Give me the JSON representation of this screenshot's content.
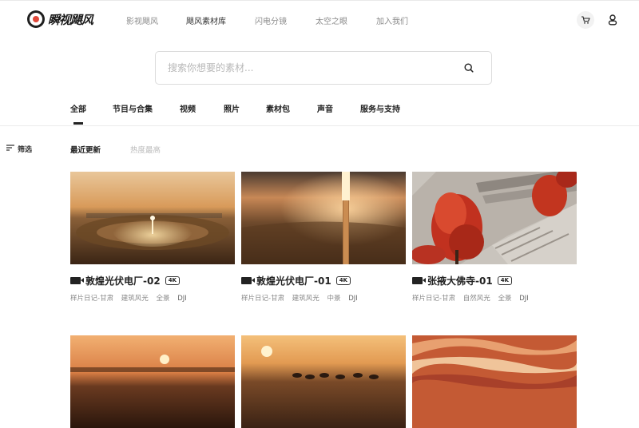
{
  "header": {
    "logo_text": "瞬视飓风",
    "nav": [
      "影视飓风",
      "飓风素材库",
      "闪电分镜",
      "太空之眼",
      "加入我们"
    ],
    "active_nav_index": 1,
    "icons": [
      "cart-icon",
      "user-icon"
    ]
  },
  "search": {
    "placeholder": "搜索你想要的素材...",
    "icon": "search-icon"
  },
  "tabs": [
    "全部",
    "节目与合集",
    "视频",
    "照片",
    "素材包",
    "声音",
    "服务与支持"
  ],
  "active_tab_index": 0,
  "filter": {
    "label": "筛选",
    "icon": "filter-icon"
  },
  "sort": [
    "最近更新",
    "热度最高"
  ],
  "active_sort_index": 0,
  "cards": [
    {
      "title": "敦煌光伏电厂-02",
      "badge": "4K",
      "tags": [
        "样片日记-甘肃",
        "建筑风光",
        "全景",
        "DJI"
      ],
      "type_icon": "video-camera-icon"
    },
    {
      "title": "敦煌光伏电厂-01",
      "badge": "4K",
      "tags": [
        "样片日记-甘肃",
        "建筑风光",
        "中景",
        "DJI"
      ],
      "type_icon": "video-camera-icon"
    },
    {
      "title": "张掖大佛寺-01",
      "badge": "4K",
      "tags": [
        "样片日记-甘肃",
        "自然风光",
        "全景",
        "DJI"
      ],
      "type_icon": "video-camera-icon"
    },
    {
      "title": "",
      "badge": "",
      "tags": [],
      "type_icon": ""
    },
    {
      "title": "",
      "badge": "",
      "tags": [],
      "type_icon": ""
    },
    {
      "title": "",
      "badge": "",
      "tags": [],
      "type_icon": ""
    }
  ]
}
